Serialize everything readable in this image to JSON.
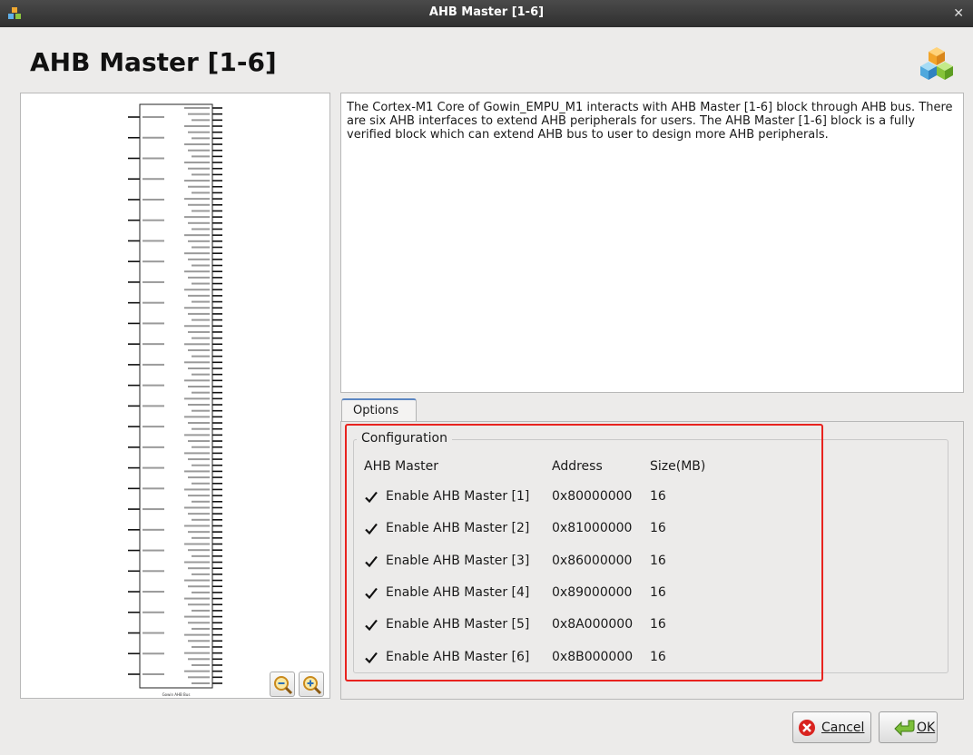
{
  "window": {
    "title": "AHB Master [1-6]"
  },
  "header": {
    "title": "AHB Master [1-6]"
  },
  "symbol": {
    "caption": "Gowin AHB Bus"
  },
  "description": "The Cortex-M1 Core of Gowin_EMPU_M1 interacts with AHB Master [1-6] block through AHB bus. There are six AHB interfaces to extend AHB peripherals for users. The AHB Master [1-6] block is a fully verified block which can extend AHB bus to user to design more AHB peripherals.",
  "tabs": [
    {
      "label": "Options",
      "active": true
    }
  ],
  "configuration": {
    "title": "Configuration",
    "headers": {
      "master": "AHB Master",
      "address": "Address",
      "size": "Size(MB)"
    },
    "rows": [
      {
        "label": "Enable AHB Master [1]",
        "checked": true,
        "address": "0x80000000",
        "size": "16"
      },
      {
        "label": "Enable AHB Master [2]",
        "checked": true,
        "address": "0x81000000",
        "size": "16"
      },
      {
        "label": "Enable AHB Master [3]",
        "checked": true,
        "address": "0x86000000",
        "size": "16"
      },
      {
        "label": "Enable AHB Master [4]",
        "checked": true,
        "address": "0x89000000",
        "size": "16"
      },
      {
        "label": "Enable AHB Master [5]",
        "checked": true,
        "address": "0x8A000000",
        "size": "16"
      },
      {
        "label": "Enable AHB Master [6]",
        "checked": true,
        "address": "0x8B000000",
        "size": "16"
      }
    ]
  },
  "buttons": {
    "cancel": "Cancel",
    "ok": "OK"
  },
  "icons": {
    "app": "app-cubes-icon",
    "close": "close-icon",
    "zoom_out": "zoom-out-icon",
    "zoom_in": "zoom-in-icon",
    "cancel": "cancel-icon",
    "ok": "ok-arrow-icon"
  },
  "colors": {
    "highlight": "#e8231f",
    "tab_accent": "#5b86c2",
    "titlebar": "#3a3a3a"
  }
}
